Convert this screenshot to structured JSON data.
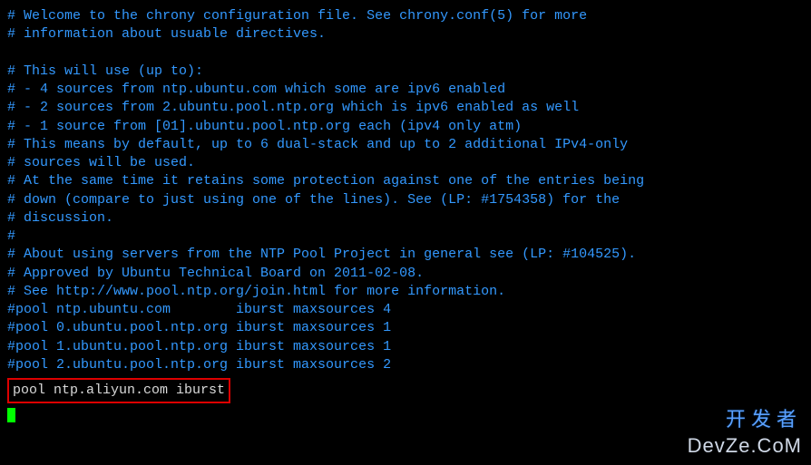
{
  "lines": [
    "# Welcome to the chrony configuration file. See chrony.conf(5) for more",
    "# information about usuable directives.",
    "",
    "# This will use (up to):",
    "# - 4 sources from ntp.ubuntu.com which some are ipv6 enabled",
    "# - 2 sources from 2.ubuntu.pool.ntp.org which is ipv6 enabled as well",
    "# - 1 source from [01].ubuntu.pool.ntp.org each (ipv4 only atm)",
    "# This means by default, up to 6 dual-stack and up to 2 additional IPv4-only",
    "# sources will be used.",
    "# At the same time it retains some protection against one of the entries being",
    "# down (compare to just using one of the lines). See (LP: #1754358) for the",
    "# discussion.",
    "#",
    "# About using servers from the NTP Pool Project in general see (LP: #104525).",
    "# Approved by Ubuntu Technical Board on 2011-02-08.",
    "# See http://www.pool.ntp.org/join.html for more information.",
    "#pool ntp.ubuntu.com        iburst maxsources 4",
    "#pool 0.ubuntu.pool.ntp.org iburst maxsources 1",
    "#pool 1.ubuntu.pool.ntp.org iburst maxsources 1",
    "#pool 2.ubuntu.pool.ntp.org iburst maxsources 2"
  ],
  "highlighted_line": "pool ntp.aliyun.com iburst",
  "watermark": {
    "cn": "开发者",
    "en": "DevZe.CoM"
  }
}
